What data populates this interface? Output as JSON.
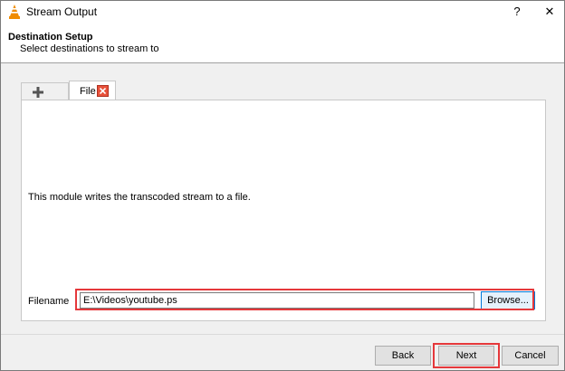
{
  "window": {
    "title": "Stream Output",
    "help_glyph": "?",
    "close_glyph": "✕",
    "icon": "vlc-cone-icon"
  },
  "header": {
    "heading": "Destination Setup",
    "subheading": "Select destinations to stream to"
  },
  "tabs": [
    {
      "name": "add-tab",
      "icon": "plus-icon"
    },
    {
      "name": "file-tab",
      "label": "File",
      "close_icon": "close-icon"
    }
  ],
  "panel": {
    "description": "This module writes the transcoded stream to a file.",
    "filename_label": "Filename",
    "filename_value": "E:\\Videos\\youtube.ps",
    "browse_label": "Browse..."
  },
  "footer": {
    "back_label": "Back",
    "next_label": "Next",
    "cancel_label": "Cancel"
  },
  "colors": {
    "highlight": "#e5383b",
    "tab_close": "#e8513a",
    "vlc_orange": "#f08c00",
    "focus_blue": "#0078d7"
  }
}
